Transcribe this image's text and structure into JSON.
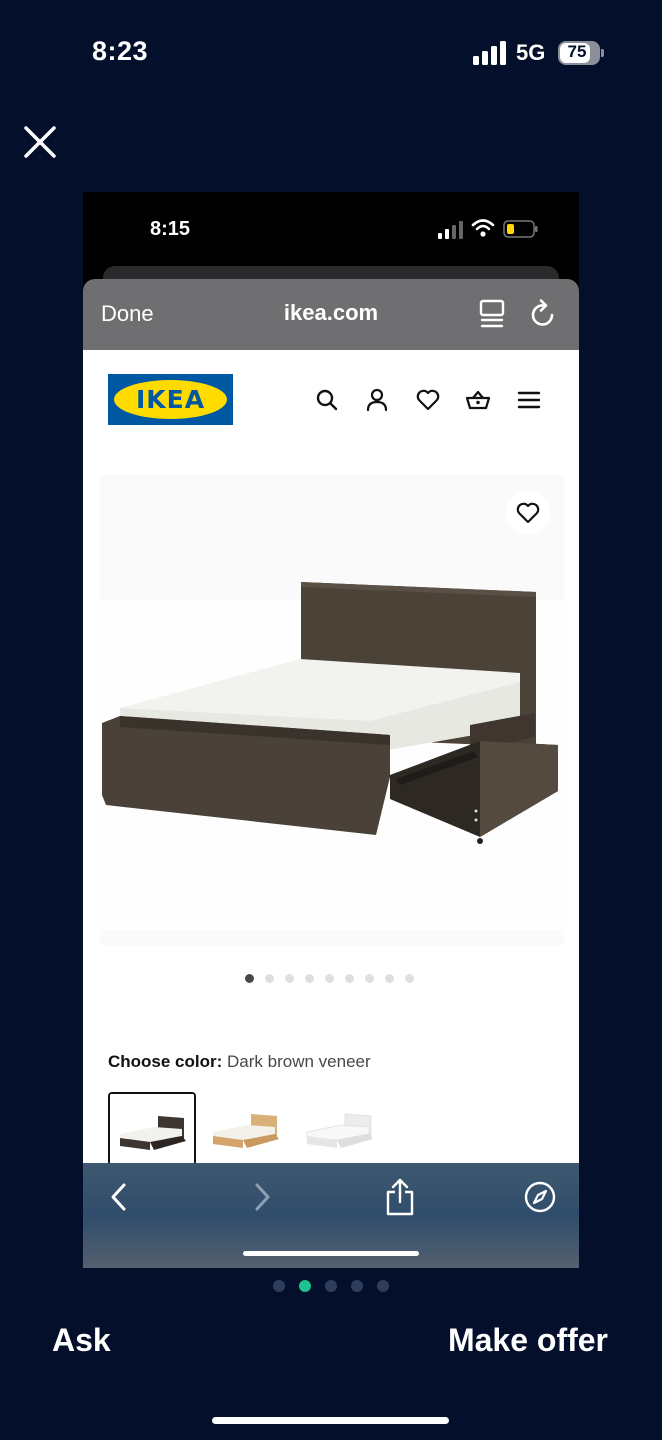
{
  "status_bar": {
    "time": "8:23",
    "network": "5G",
    "battery": "75"
  },
  "screenshot": {
    "status_bar": {
      "time": "8:15"
    },
    "browser": {
      "done_label": "Done",
      "url": "ikea.com"
    },
    "site": {
      "logo": "IKEA",
      "color_label": "Choose color:",
      "color_value": "Dark brown veneer",
      "image_count": 9,
      "active_image_index": 0
    }
  },
  "footer": {
    "ask_label": "Ask",
    "offer_label": "Make offer",
    "page_count": 5,
    "active_page_index": 1
  },
  "colors": {
    "background": "#030f2b",
    "ikea_blue": "#0058a3",
    "ikea_yellow": "#ffdb00",
    "accent_green": "#1ec18f"
  }
}
